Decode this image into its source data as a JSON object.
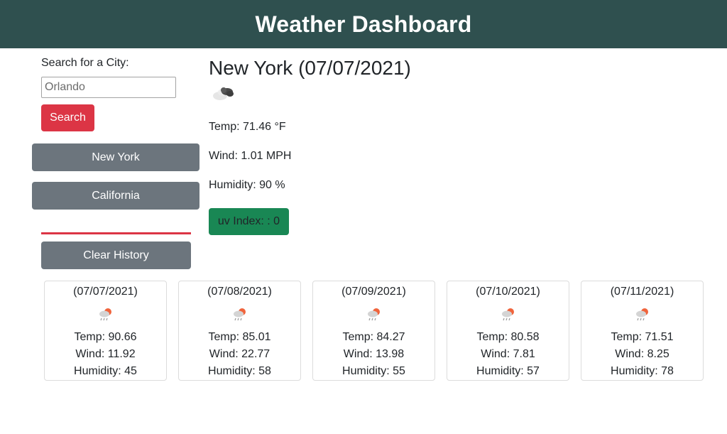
{
  "header": {
    "title": "Weather Dashboard"
  },
  "search": {
    "label": "Search for a City:",
    "value": "Orlando",
    "button_label": "Search"
  },
  "history": {
    "items": [
      "New York",
      "California"
    ],
    "clear_label": "Clear History"
  },
  "current": {
    "title": "New York (07/07/2021)",
    "icon": "cloudy-icon",
    "temp": "Temp: 71.46 °F",
    "wind": "Wind: 1.01 MPH",
    "humidity": "Humidity: 90 %",
    "uv": "uv Index: : 0"
  },
  "forecast": [
    {
      "date": "(07/07/2021)",
      "icon": "rain-sun-icon",
      "temp": "Temp: 90.66",
      "wind": "Wind: 11.92",
      "humidity": "Humidity: 45"
    },
    {
      "date": "(07/08/2021)",
      "icon": "rain-sun-icon",
      "temp": "Temp: 85.01",
      "wind": "Wind: 22.77",
      "humidity": "Humidity: 58"
    },
    {
      "date": "(07/09/2021)",
      "icon": "rain-sun-icon",
      "temp": "Temp: 84.27",
      "wind": "Wind: 13.98",
      "humidity": "Humidity: 55"
    },
    {
      "date": "(07/10/2021)",
      "icon": "rain-sun-icon",
      "temp": "Temp: 80.58",
      "wind": "Wind: 7.81",
      "humidity": "Humidity: 57"
    },
    {
      "date": "(07/11/2021)",
      "icon": "rain-sun-icon",
      "temp": "Temp: 71.51",
      "wind": "Wind: 8.25",
      "humidity": "Humidity: 78"
    }
  ],
  "colors": {
    "header_bg": "#2f504f",
    "search_button": "#dc3545",
    "history_button": "#6c757d",
    "uv_badge": "#198754"
  }
}
